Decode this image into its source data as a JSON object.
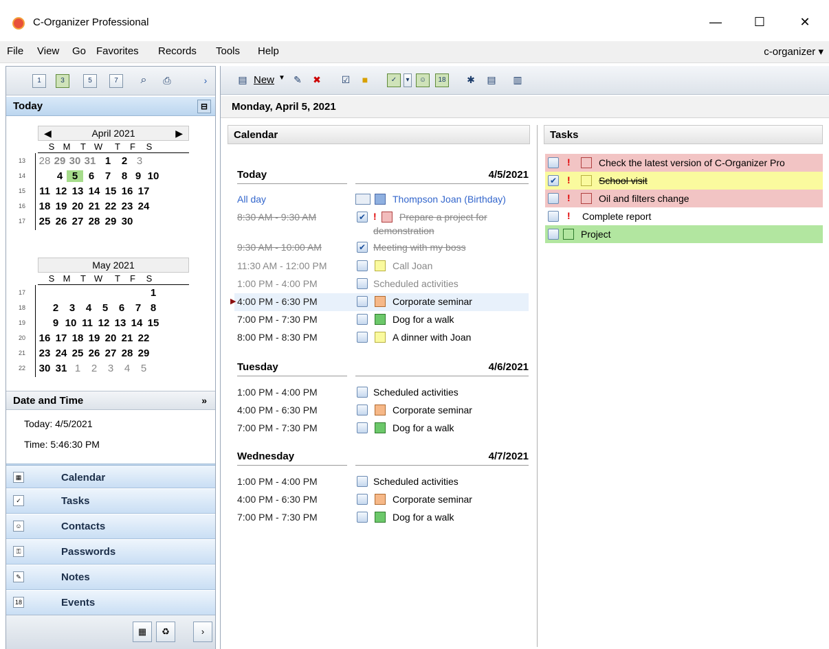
{
  "window": {
    "title": "C-Organizer Professional",
    "minimize": "—",
    "maximize": "☐",
    "close": "✕"
  },
  "menu": {
    "items": [
      "File",
      "View",
      "Go",
      "Favorites",
      "Records",
      "Tools",
      "Help"
    ],
    "org_link": "c-organizer ▾"
  },
  "left_toolbar": {
    "icons": [
      "1",
      "3",
      "5",
      "7"
    ]
  },
  "today_panel": {
    "title": "Today",
    "pin": "⊟"
  },
  "april": {
    "label": "April 2021",
    "prev": "◀",
    "next": "▶",
    "days": [
      "S",
      "M",
      "T",
      "W",
      "T",
      "F",
      "S"
    ],
    "weeks": [
      {
        "n": "13",
        "d": [
          "28",
          "29",
          "30",
          "31",
          "1",
          "2",
          "3"
        ]
      },
      {
        "n": "14",
        "d": [
          "",
          "4",
          "5",
          "6",
          "7",
          "8",
          "9",
          "10"
        ]
      },
      {
        "n": "15",
        "d": [
          "11",
          "12",
          "13",
          "14",
          "15",
          "16",
          "17"
        ]
      },
      {
        "n": "16",
        "d": [
          "18",
          "19",
          "20",
          "21",
          "22",
          "23",
          "24"
        ]
      },
      {
        "n": "17",
        "d": [
          "25",
          "26",
          "27",
          "28",
          "29",
          "30"
        ]
      }
    ]
  },
  "may": {
    "label": "May 2021",
    "days": [
      "S",
      "M",
      "T",
      "W",
      "T",
      "F",
      "S"
    ],
    "weeks": [
      {
        "n": "17",
        "d": [
          "1"
        ]
      },
      {
        "n": "18",
        "d": [
          "2",
          "3",
          "4",
          "5",
          "6",
          "7",
          "8"
        ]
      },
      {
        "n": "19",
        "d": [
          "9",
          "10",
          "11",
          "12",
          "13",
          "14",
          "15"
        ]
      },
      {
        "n": "20",
        "d": [
          "16",
          "17",
          "18",
          "19",
          "20",
          "21",
          "22"
        ]
      },
      {
        "n": "21",
        "d": [
          "23",
          "24",
          "25",
          "26",
          "27",
          "28",
          "29"
        ]
      },
      {
        "n": "22",
        "d": [
          "30",
          "31",
          "1",
          "2",
          "3",
          "4",
          "5"
        ]
      }
    ]
  },
  "date_time": {
    "title": "Date and Time",
    "chevron": "»",
    "today": "Today: 4/5/2021",
    "time": "Time: 5:46:30 PM"
  },
  "nav": [
    "Calendar",
    "Tasks",
    "Contacts",
    "Passwords",
    "Notes",
    "Events"
  ],
  "toolbar": {
    "new_label": "New"
  },
  "main": {
    "date_header": "Monday, April 5, 2021",
    "calendar_title": "Calendar",
    "tasks_title": "Tasks",
    "days": [
      {
        "label": "Today",
        "date": "4/5/2021"
      },
      {
        "label": "Tuesday",
        "date": "4/6/2021"
      },
      {
        "label": "Wednesday",
        "date": "4/7/2021"
      }
    ],
    "events_today": [
      {
        "time": "All day",
        "title": "Thompson Joan (Birthday)"
      },
      {
        "time": "8:30 AM - 9:30 AM",
        "title": "Prepare a project for",
        "title2": "demonstration"
      },
      {
        "time": "9:30 AM - 10:00 AM",
        "title": "Meeting with my boss"
      },
      {
        "time": "11:30 AM - 12:00 PM",
        "title": "Call Joan"
      },
      {
        "time": "1:00 PM - 4:00 PM",
        "title": "Scheduled activities"
      },
      {
        "time": "4:00 PM - 6:30 PM",
        "title": "Corporate seminar"
      },
      {
        "time": "7:00 PM - 7:30 PM",
        "title": "Dog for a walk"
      },
      {
        "time": "8:00 PM - 8:30 PM",
        "title": "A dinner with Joan"
      }
    ],
    "events_tue": [
      {
        "time": "1:00 PM - 4:00 PM",
        "title": "Scheduled activities"
      },
      {
        "time": "4:00 PM - 6:30 PM",
        "title": "Corporate seminar"
      },
      {
        "time": "7:00 PM - 7:30 PM",
        "title": "Dog for a walk"
      }
    ],
    "events_wed": [
      {
        "time": "1:00 PM - 4:00 PM",
        "title": "Scheduled activities"
      },
      {
        "time": "4:00 PM - 6:30 PM",
        "title": "Corporate seminar"
      },
      {
        "time": "7:00 PM - 7:30 PM",
        "title": "Dog for a walk"
      }
    ],
    "tasks": [
      {
        "title": "Check the latest version of C-Organizer Pro"
      },
      {
        "title": "School visit"
      },
      {
        "title": "Oil and filters change"
      },
      {
        "title": "Complete report"
      },
      {
        "title": "Project"
      }
    ],
    "bang": "!",
    "check": "✔"
  },
  "colors": {
    "red_row": "#f2c4c4",
    "yellow_row": "#fafa9e",
    "green_row": "#b2e6a0",
    "orange": "#f6b888",
    "green": "#6cc86a",
    "yellow": "#fafa9e",
    "blue": "#8fb0e0",
    "pink": "#f2bcbc"
  }
}
